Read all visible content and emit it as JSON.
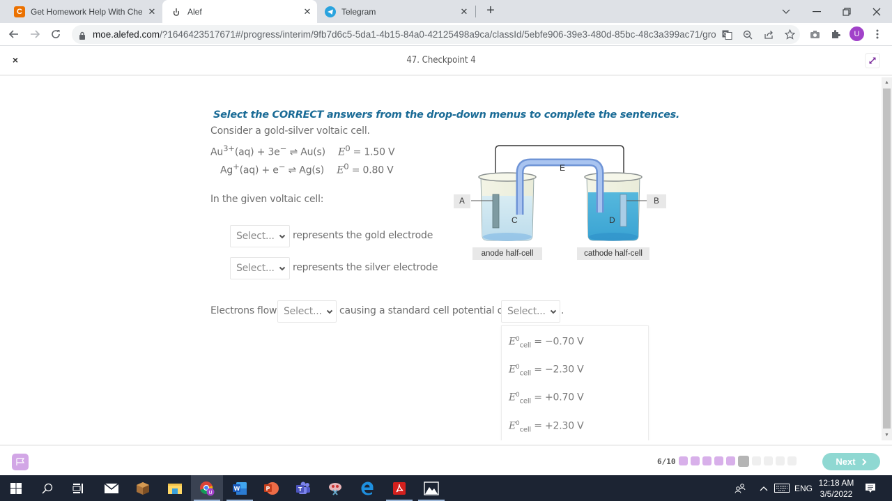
{
  "browser": {
    "tabs": [
      {
        "title": "Get Homework Help With Chegg",
        "icon": "chegg-icon",
        "active": false
      },
      {
        "title": "Alef",
        "icon": "alef-icon",
        "active": true
      },
      {
        "title": "Telegram",
        "icon": "telegram-icon",
        "active": false
      }
    ],
    "close_glyph": "✕",
    "new_tab_glyph": "+",
    "url_host": "moe.alefed.com",
    "url_path": "/?1646423517671#/progress/interim/9fb7d6c5-5da1-4b15-84a0-42125498a9ca/classId/5ebfe906-39e3-480d-85bc-48c3a399ac71/grou...",
    "profile_initial": "U"
  },
  "app": {
    "title": "47. Checkpoint 4",
    "close_glyph": "×"
  },
  "question": {
    "instruction": "Select the CORRECT answers from the drop-down menus to complete the sentences.",
    "intro": "Consider a gold-silver voltaic cell.",
    "equations": [
      {
        "species": "Au",
        "charge": "3+",
        "lhs_rest": "(aq) + 3e",
        "rhs": " ⇌ Au(s)",
        "E_symbol": "E",
        "E_sup": "0",
        "E_value": " = 1.50 V"
      },
      {
        "species": "Ag",
        "charge": "+",
        "lhs_rest": "(aq) + e",
        "rhs": " ⇌ Ag(s)",
        "E_symbol": "E",
        "E_sup": "0",
        "E_value": " = 0.80 V"
      }
    ],
    "electron_sup": "−",
    "lead": "In the given voltaic cell:",
    "sentences": [
      {
        "select": "Select...",
        "text": "represents the gold electrode"
      },
      {
        "select": "Select...",
        "text": "represents the silver electrode"
      }
    ],
    "electron_sentence": {
      "prefix": "Electrons flow",
      "select1": "Select...",
      "middle": "causing a standard cell potential of",
      "select2": "Select...",
      "suffix": "."
    },
    "dropdown_options": [
      {
        "symbol": "E",
        "sup": "0",
        "sub": "cell",
        "value": " = −0.70 V"
      },
      {
        "symbol": "E",
        "sup": "0",
        "sub": "cell",
        "value": " = −2.30 V"
      },
      {
        "symbol": "E",
        "sup": "0",
        "sub": "cell",
        "value": " = +0.70 V"
      },
      {
        "symbol": "E",
        "sup": "0",
        "sub": "cell",
        "value": " = +2.30 V"
      }
    ]
  },
  "diagram": {
    "labels": {
      "A": "A",
      "B": "B",
      "C": "C",
      "D": "D",
      "E": "E"
    },
    "anode_caption": "anode half-cell",
    "cathode_caption": "cathode half-cell"
  },
  "footer": {
    "progress_text": "6/10",
    "progress": {
      "current": 6,
      "total": 10,
      "completed": 5
    },
    "next_label": "Next",
    "next_glyph": "›"
  },
  "taskbar": {
    "apps": [
      "start",
      "search",
      "task-view",
      "mail",
      "minecraft",
      "file-explorer",
      "chrome",
      "word",
      "powerpoint",
      "teams",
      "snipping",
      "edge",
      "acrobat",
      "photos"
    ],
    "language": "ENG",
    "time": "12:18 AM",
    "date": "3/5/2022"
  },
  "colors": {
    "instruction": "#1a6b96",
    "accent_purple": "#a142c9",
    "progress_done": "#d8b0ea",
    "next_button": "#8fd8d2"
  }
}
